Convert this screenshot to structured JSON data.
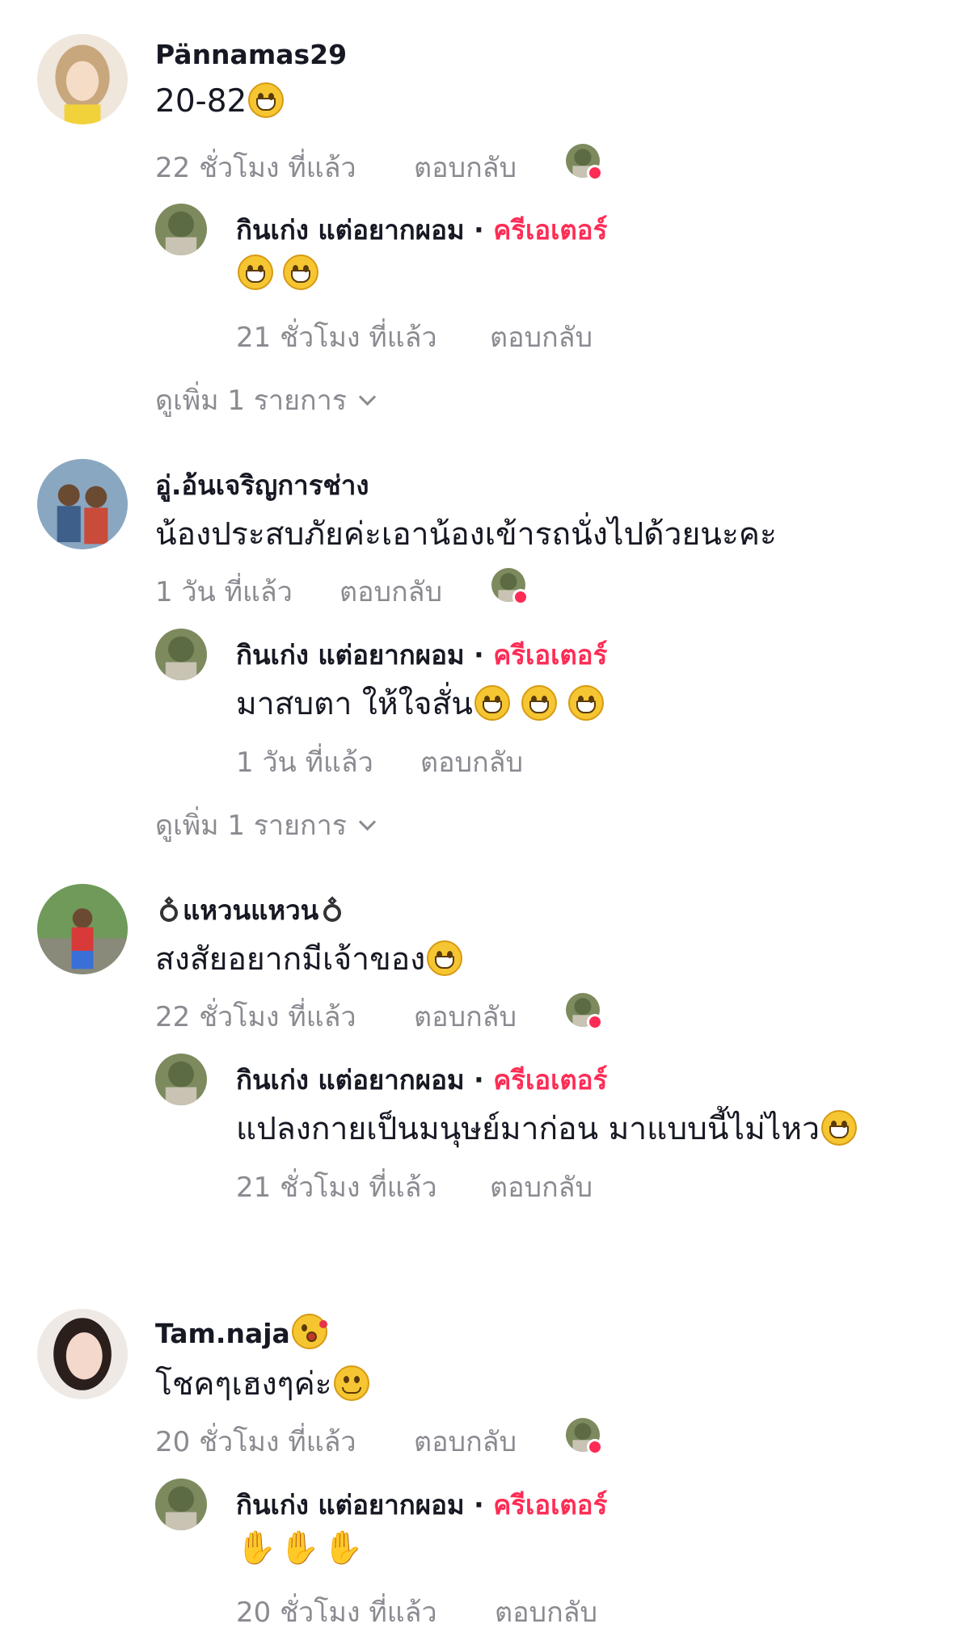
{
  "comments": [
    {
      "username": "Pännamas29",
      "text": "20-82",
      "time": "22 ชั่วโมง ที่แล้ว",
      "reply_label": "ตอบกลับ",
      "avatar": "anime-girl-avatar",
      "creator_reply": {
        "username": "กินเก่ง แต่อยากผอม",
        "separator": " · ",
        "badge": "ครีเอเตอร์",
        "text": "",
        "time": "21 ชั่วโมง ที่แล้ว",
        "reply_label": "ตอบกลับ"
      },
      "view_more": "ดูเพิ่ม 1 รายการ"
    },
    {
      "username": "อู่.อ้นเจริญการช่าง",
      "text": "น้องประสบภัยค่ะเอาน้องเข้ารถนั่งไปด้วยนะคะ",
      "time": "1 วัน ที่แล้ว",
      "reply_label": "ตอบกลับ",
      "avatar": "kids-avatar",
      "creator_reply": {
        "username": "กินเก่ง แต่อยากผอม",
        "separator": " · ",
        "badge": "ครีเอเตอร์",
        "text": "มาสบตา ให้ใจสั่น",
        "time": "1 วัน ที่แล้ว",
        "reply_label": "ตอบกลับ"
      },
      "view_more": "ดูเพิ่ม 1 รายการ"
    },
    {
      "username": "แหวนแหวน",
      "text": "สงสัยอยากมีเจ้าของ",
      "time": "22 ชั่วโมง ที่แล้ว",
      "reply_label": "ตอบกลับ",
      "avatar": "person-outdoor-avatar",
      "creator_reply": {
        "username": "กินเก่ง แต่อยากผอม",
        "separator": " · ",
        "badge": "ครีเอเตอร์",
        "text": "แปลงกายเป็นมนุษย์มาก่อน มาแบบนี้ไม่ไหว",
        "time": "21 ชั่วโมง ที่แล้ว",
        "reply_label": "ตอบกลับ"
      }
    },
    {
      "username": "Tam.naja",
      "text": "โชคๆเฮงๆค่ะ",
      "time": "20 ชั่วโมง ที่แล้ว",
      "reply_label": "ตอบกลับ",
      "avatar": "woman-avatar",
      "creator_reply": {
        "username": "กินเก่ง แต่อยากผอม",
        "separator": " · ",
        "badge": "ครีเอเตอร์",
        "text": "",
        "time": "20 ชั่วโมง ที่แล้ว",
        "reply_label": "ตอบกลับ"
      }
    }
  ],
  "colors": {
    "creator_badge": "#fe2c55",
    "meta": "#8a8b91",
    "text": "#161823"
  }
}
